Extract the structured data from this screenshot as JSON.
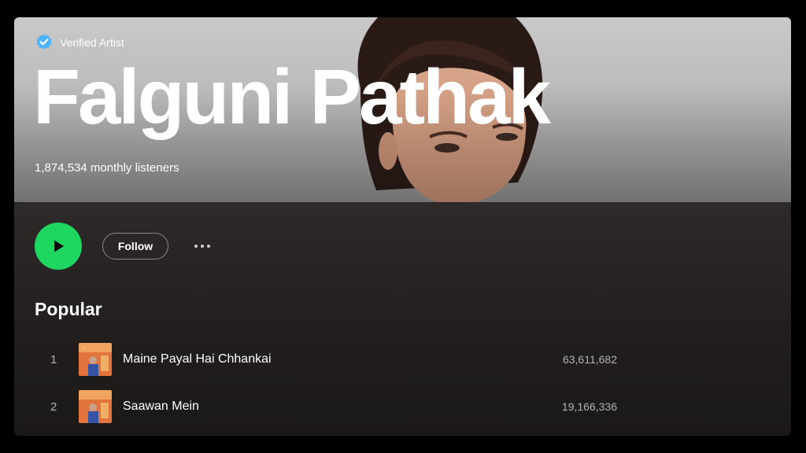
{
  "artist": {
    "verified_label": "Verified Artist",
    "name": "Falguni Pathak",
    "monthly_listeners": "1,874,534 monthly listeners"
  },
  "actions": {
    "follow_label": "Follow"
  },
  "popular": {
    "title": "Popular",
    "tracks": [
      {
        "number": "1",
        "title": "Maine Payal Hai Chhankai",
        "plays": "63,611,682"
      },
      {
        "number": "2",
        "title": "Saawan Mein",
        "plays": "19,166,336"
      }
    ]
  },
  "colors": {
    "accent": "#1ed760",
    "verified_badge": "#4cb3ff"
  },
  "icons": [
    "verified-badge-icon",
    "play-icon",
    "more-options-icon"
  ]
}
